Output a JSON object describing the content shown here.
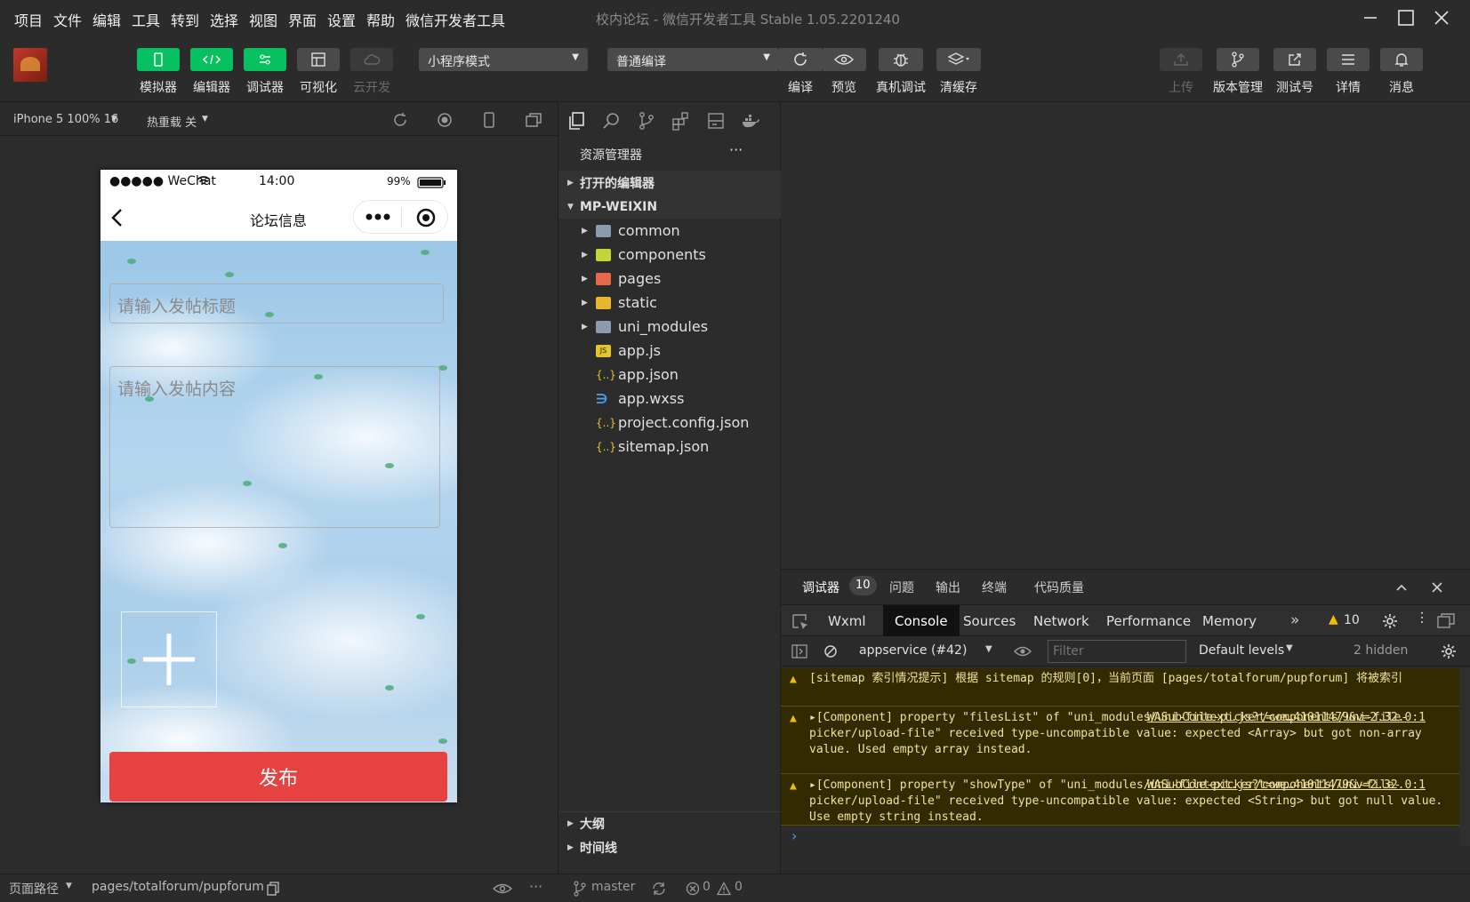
{
  "menubar": {
    "items": [
      "项目",
      "文件",
      "编辑",
      "工具",
      "转到",
      "选择",
      "视图",
      "界面",
      "设置",
      "帮助",
      "微信开发者工具"
    ],
    "title": "校内论坛 - 微信开发者工具 Stable 1.05.2201240"
  },
  "toolbar": {
    "left": [
      {
        "label": "模拟器",
        "icon": "phone-icon"
      },
      {
        "label": "编辑器",
        "icon": "code-icon"
      },
      {
        "label": "调试器",
        "icon": "debug-icon"
      },
      {
        "label": "可视化",
        "icon": "layout-icon"
      },
      {
        "label": "云开发",
        "icon": "cloud-icon"
      }
    ],
    "mode": "小程序模式",
    "compile": "普通编译",
    "mid": [
      {
        "label": "编译",
        "icon": "refresh-icon"
      },
      {
        "label": "预览",
        "icon": "eye-icon"
      },
      {
        "label": "真机调试",
        "icon": "bug-icon"
      },
      {
        "label": "清缓存",
        "icon": "layers-icon"
      }
    ],
    "right": [
      {
        "label": "上传",
        "icon": "upload-icon"
      },
      {
        "label": "版本管理",
        "icon": "branch-icon"
      },
      {
        "label": "测试号",
        "icon": "external-icon"
      },
      {
        "label": "详情",
        "icon": "menu-icon"
      },
      {
        "label": "消息",
        "icon": "bell-icon"
      }
    ]
  },
  "simulator": {
    "device": "iPhone 5 100% 16",
    "hotreload": "热重载 关"
  },
  "phone": {
    "carrier": "●●●●● WeChat",
    "time": "14:00",
    "battery": "99%",
    "nav_title": "论坛信息",
    "title_placeholder": "请输入发帖标题",
    "content_placeholder": "请输入发帖内容",
    "publish": "发布"
  },
  "explorer": {
    "header": "资源管理器",
    "more": "···",
    "open_editors": "打开的编辑器",
    "root": "MP-WEIXIN",
    "items": [
      {
        "name": "common",
        "type": "folder",
        "color": "#8a9bb0"
      },
      {
        "name": "components",
        "type": "folder",
        "color": "#c6d43a"
      },
      {
        "name": "pages",
        "type": "folder",
        "color": "#e8684a"
      },
      {
        "name": "static",
        "type": "folder",
        "color": "#e6b72d"
      },
      {
        "name": "uni_modules",
        "type": "folder",
        "color": "#8a9bb0"
      },
      {
        "name": "app.js",
        "type": "js"
      },
      {
        "name": "app.json",
        "type": "json"
      },
      {
        "name": "app.wxss",
        "type": "css"
      },
      {
        "name": "project.config.json",
        "type": "json"
      },
      {
        "name": "sitemap.json",
        "type": "json"
      }
    ],
    "outline": "大纲",
    "timeline": "时间线"
  },
  "debug": {
    "tabs": [
      "调试器",
      "问题",
      "输出",
      "终端",
      "代码质量"
    ],
    "badge": "10",
    "ctabs": [
      "Wxml",
      "Console",
      "Sources",
      "Network",
      "Performance",
      "Memory"
    ],
    "warn_count": "10",
    "context": "appservice (#42)",
    "filter_placeholder": "Filter",
    "levels": "Default levels",
    "hidden": "2 hidden",
    "logs": [
      {
        "text": "[sitemap 索引情况提示] 根据 sitemap 的规则[0]，当前页面 [pages/totalforum/pupforum] 将被索引",
        "link": ""
      },
      {
        "text": "▸[Component] property \"filesList\" of \"uni_modules/uni-file-picker/components/uni-file-picker/upload-file\" received type-uncompatible value: expected <Array> but got non-array value. Used empty array instead.",
        "link": "WASubContext.js?t=we…41011479&v=2.32.0:1"
      },
      {
        "text": "▸[Component] property \"showType\" of \"uni_modules/uni-file-picker/components/uni-file-picker/upload-file\" received type-uncompatible value: expected <String> but got null value. Use empty string instead.",
        "link": "WASubContext.js?t=we…41011479&v=2.32.0:1"
      }
    ],
    "prompt": "›"
  },
  "statusbar": {
    "path_label": "页面路径",
    "path": "pages/totalforum/pupforum",
    "branch": "master",
    "errors": "0",
    "warnings": "0"
  }
}
